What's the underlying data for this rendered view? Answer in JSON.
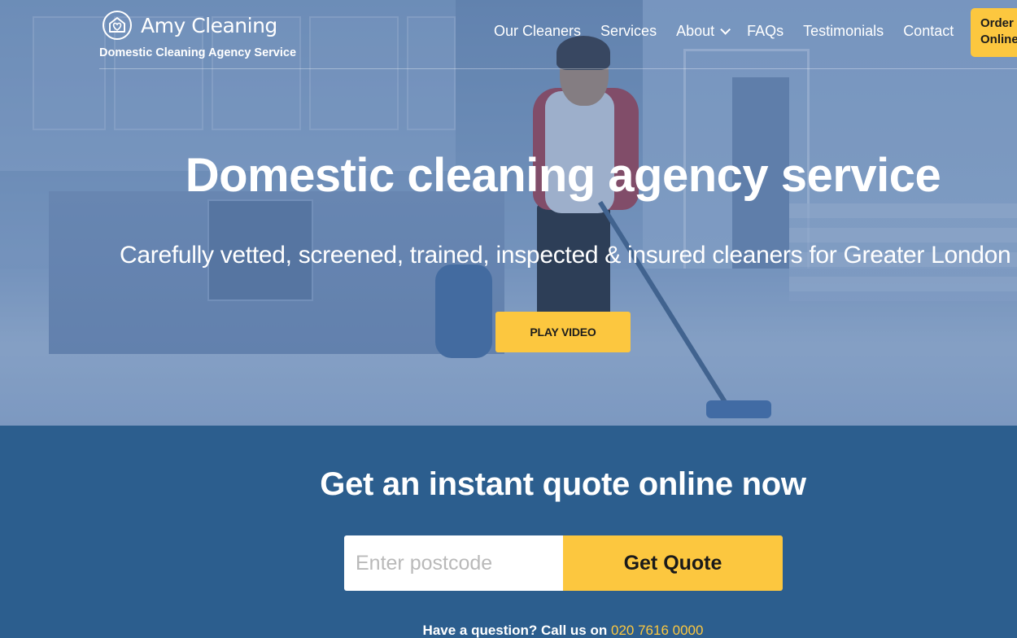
{
  "header": {
    "brand_name": "Amy Cleaning",
    "tagline": "Domestic Cleaning Agency Service",
    "logo_icon": "house-heart-icon",
    "nav": [
      {
        "label": "Our Cleaners"
      },
      {
        "label": "Services"
      },
      {
        "label": "About",
        "dropdown": true
      },
      {
        "label": "FAQs"
      },
      {
        "label": "Testimonials"
      },
      {
        "label": "Contact"
      }
    ],
    "order_line1": "Order",
    "order_line2": "Online"
  },
  "hero": {
    "title": "Domestic cleaning agency service",
    "subtitle": "Carefully vetted, screened, trained, inspected & insured cleaners for Greater London",
    "play_label": "PLAY VIDEO"
  },
  "quote": {
    "title_prefix": "Get an instant quote online",
    "title_emphasis": "now",
    "postcode_placeholder": "Enter postcode",
    "button_label": "Get Quote",
    "question_prefix": "Have a question? Call us on",
    "phone": "020 7616 0000"
  },
  "colors": {
    "accent": "#fcc73f",
    "section_bg": "#2c5e8e"
  }
}
